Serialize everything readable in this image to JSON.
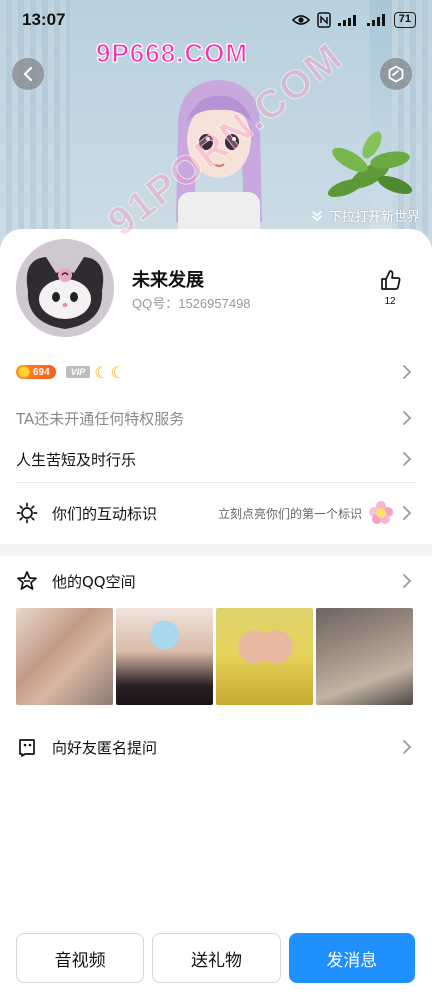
{
  "status_bar": {
    "time": "13:07",
    "battery": "71"
  },
  "banner": {
    "watermark": "9P668.COM",
    "pull_hint": "下拉打开新世界"
  },
  "profile": {
    "nickname": "未来发展",
    "qq_label": "QQ号：",
    "qq_number": "1526957498",
    "like_count": "12",
    "level": "694",
    "vip": "VIP"
  },
  "rows": {
    "privilege": "TA还未开通任何特权服务",
    "signature": "人生苦短及时行乐",
    "interaction_title": "你们的互动标识",
    "interaction_hint": "立刻点亮你们的第一个标识",
    "qzone_title": "他的QQ空间",
    "anonymous_title": "向好友匿名提问"
  },
  "overlay_watermark": "91PORN.COM",
  "buttons": {
    "av": "音视频",
    "gift": "送礼物",
    "message": "发消息"
  },
  "colors": {
    "accent": "#1e90ff",
    "level_badge": "#ff6a1f"
  }
}
